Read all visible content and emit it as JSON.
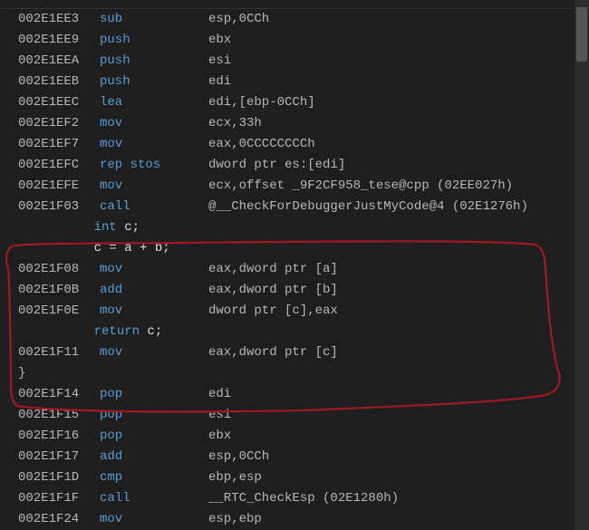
{
  "lines": [
    {
      "type": "asm",
      "addr": "002E1EE3",
      "mnemonic": "sub",
      "operand": "esp,0CCh"
    },
    {
      "type": "asm",
      "addr": "002E1EE9",
      "mnemonic": "push",
      "operand": "ebx"
    },
    {
      "type": "asm",
      "addr": "002E1EEA",
      "mnemonic": "push",
      "operand": "esi"
    },
    {
      "type": "asm",
      "addr": "002E1EEB",
      "mnemonic": "push",
      "operand": "edi"
    },
    {
      "type": "asm",
      "addr": "002E1EEC",
      "mnemonic": "lea",
      "operand": "edi,[ebp-0CCh]"
    },
    {
      "type": "asm",
      "addr": "002E1EF2",
      "mnemonic": "mov",
      "operand": "ecx,33h"
    },
    {
      "type": "asm",
      "addr": "002E1EF7",
      "mnemonic": "mov",
      "operand": "eax,0CCCCCCCCh"
    },
    {
      "type": "asm",
      "addr": "002E1EFC",
      "mnemonic": "rep stos",
      "operand": "dword ptr es:[edi]"
    },
    {
      "type": "asm",
      "addr": "002E1EFE",
      "mnemonic": "mov",
      "operand": "ecx,offset _9F2CF958_tese@cpp (02EE027h)"
    },
    {
      "type": "asm",
      "addr": "002E1F03",
      "mnemonic": "call",
      "operand": "@__CheckForDebuggerJustMyCode@4 (02E1276h)"
    },
    {
      "type": "src",
      "text": "    int c;",
      "kw": "int"
    },
    {
      "type": "src",
      "text": "    c = a + b;"
    },
    {
      "type": "asm",
      "addr": "002E1F08",
      "mnemonic": "mov",
      "operand": "eax,dword ptr [a]"
    },
    {
      "type": "asm",
      "addr": "002E1F0B",
      "mnemonic": "add",
      "operand": "eax,dword ptr [b]"
    },
    {
      "type": "asm",
      "addr": "002E1F0E",
      "mnemonic": "mov",
      "operand": "dword ptr [c],eax"
    },
    {
      "type": "src",
      "text": "    return c;",
      "kw": "return"
    },
    {
      "type": "asm",
      "addr": "002E1F11",
      "mnemonic": "mov",
      "operand": "eax,dword ptr [c]"
    },
    {
      "type": "brace",
      "text": "}"
    },
    {
      "type": "asm",
      "addr": "002E1F14",
      "mnemonic": "pop",
      "operand": "edi"
    },
    {
      "type": "asm",
      "addr": "002E1F15",
      "mnemonic": "pop",
      "operand": "esi"
    },
    {
      "type": "asm",
      "addr": "002E1F16",
      "mnemonic": "pop",
      "operand": "ebx"
    },
    {
      "type": "asm",
      "addr": "002E1F17",
      "mnemonic": "add",
      "operand": "esp,0CCh"
    },
    {
      "type": "asm",
      "addr": "002E1F1D",
      "mnemonic": "cmp",
      "operand": "ebp,esp"
    },
    {
      "type": "asm",
      "addr": "002E1F1F",
      "mnemonic": "call",
      "operand": "__RTC_CheckEsp (02E1280h)"
    },
    {
      "type": "asm",
      "addr": "002E1F24",
      "mnemonic": "mov",
      "operand": "esp,ebp"
    }
  ],
  "annotation_color": "#a01820"
}
